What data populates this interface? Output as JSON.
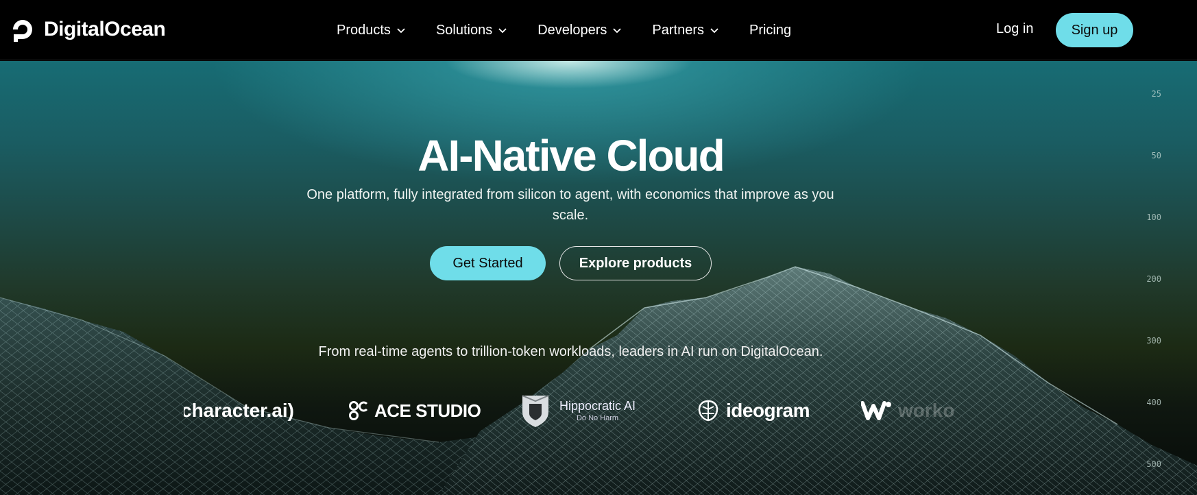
{
  "brand": {
    "name": "DigitalOcean"
  },
  "nav": {
    "items": [
      {
        "label": "Products",
        "dropdown": true
      },
      {
        "label": "Solutions",
        "dropdown": true
      },
      {
        "label": "Developers",
        "dropdown": true
      },
      {
        "label": "Partners",
        "dropdown": true
      },
      {
        "label": "Pricing",
        "dropdown": false
      }
    ],
    "login_label": "Log in",
    "signup_label": "Sign up"
  },
  "hero": {
    "title": "AI-Native Cloud",
    "subtitle": "One platform, fully integrated from silicon to agent, with economics that improve as you scale.",
    "primary_cta": "Get Started",
    "secondary_cta": "Explore products",
    "tagline": "From real-time agents to trillion-token workloads, leaders in AI run on DigitalOcean."
  },
  "logos": {
    "character": "character.ai)",
    "ace": "ACE STUDIO",
    "hippo_name": "Hippocratic AI",
    "hippo_motto": "Do No Harm",
    "ideogram": "ideogram",
    "worko": "worko"
  },
  "scale_ticks": [
    "25",
    "50",
    "100",
    "200",
    "300",
    "400",
    "500"
  ],
  "colors": {
    "accent": "#6fdde9",
    "nav_bg": "#000000",
    "text": "#ffffff"
  }
}
